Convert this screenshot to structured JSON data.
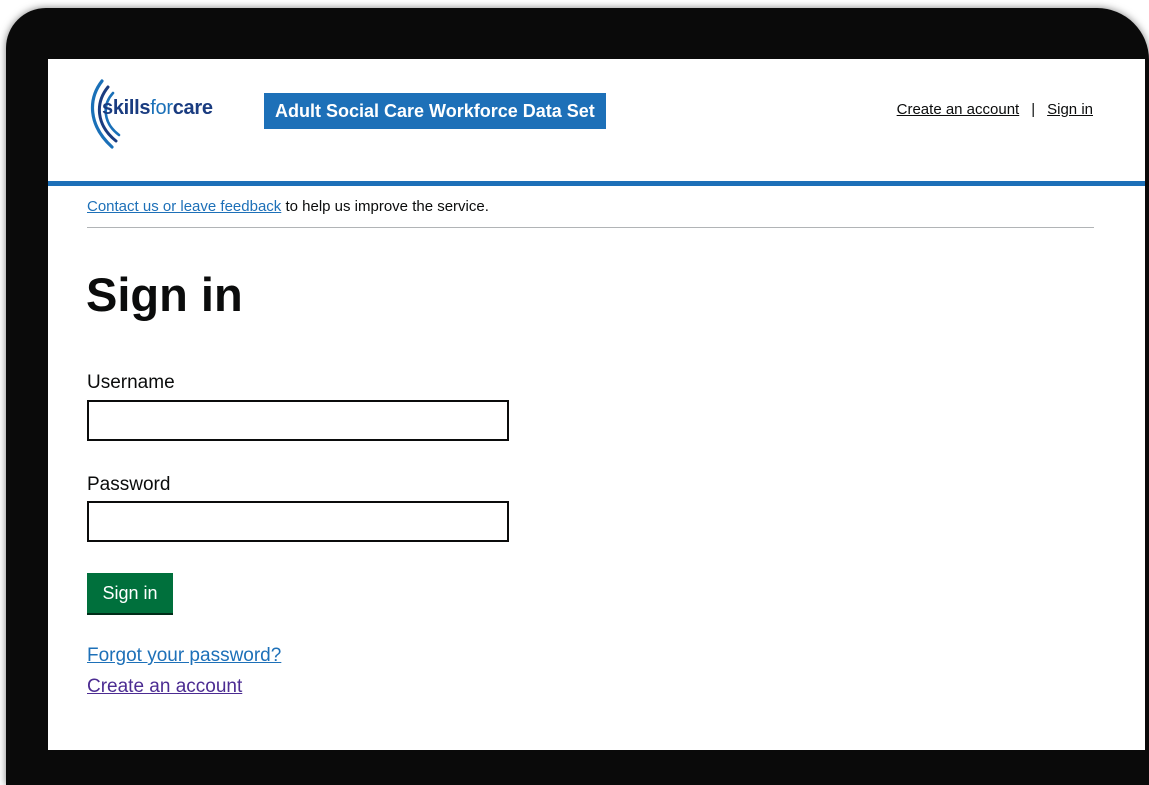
{
  "header": {
    "logo": {
      "prefix": "skills",
      "middle": "for",
      "suffix": "care"
    },
    "service_name": "Adult Social Care Workforce Data Set",
    "links": {
      "create_account": "Create an account",
      "separator": "|",
      "sign_in": "Sign in"
    }
  },
  "feedback": {
    "link_text": "Contact us or leave feedback",
    "rest_text": " to help us improve the service."
  },
  "main": {
    "title": "Sign in",
    "username_label": "Username",
    "username_value": "",
    "password_label": "Password",
    "password_value": "",
    "submit_label": "Sign in",
    "forgot_link": "Forgot your password?",
    "create_link": "Create an account"
  },
  "colors": {
    "brand_blue": "#1d70b8",
    "logo_navy": "#1a3c80",
    "button_green": "#00703c",
    "visited_link": "#4c2c92",
    "frame": "#0a0a0a"
  }
}
